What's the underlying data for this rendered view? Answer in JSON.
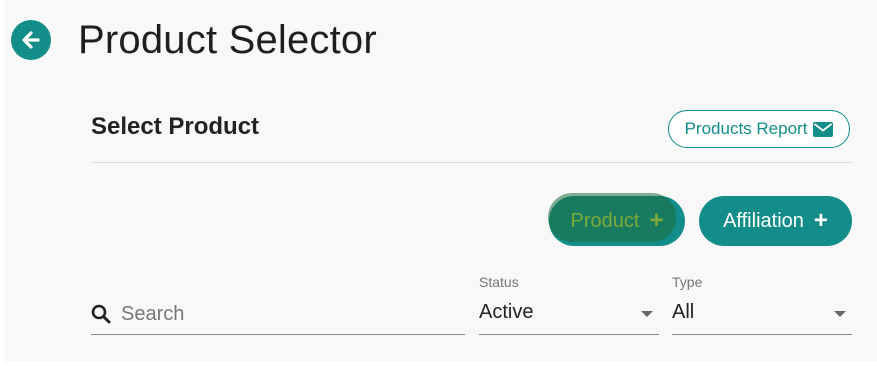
{
  "header": {
    "title": "Product Selector"
  },
  "section": {
    "title": "Select Product",
    "report_button_label": "Products Report"
  },
  "actions": {
    "product_label": "Product",
    "affiliation_label": "Affiliation",
    "plus_glyph": "+"
  },
  "filters": {
    "search": {
      "placeholder": "Search",
      "value": ""
    },
    "status": {
      "label": "Status",
      "selected": "Active"
    },
    "type": {
      "label": "Type",
      "selected": "All"
    }
  },
  "colors": {
    "accent": "#138d8a",
    "highlight_text": "#f4f13a",
    "background": "#f8f8f8"
  },
  "icons": {
    "back": "arrow-left-icon",
    "report": "envelope-icon",
    "search": "search-icon",
    "add": "plus-icon",
    "dropdown": "caret-down-icon"
  }
}
